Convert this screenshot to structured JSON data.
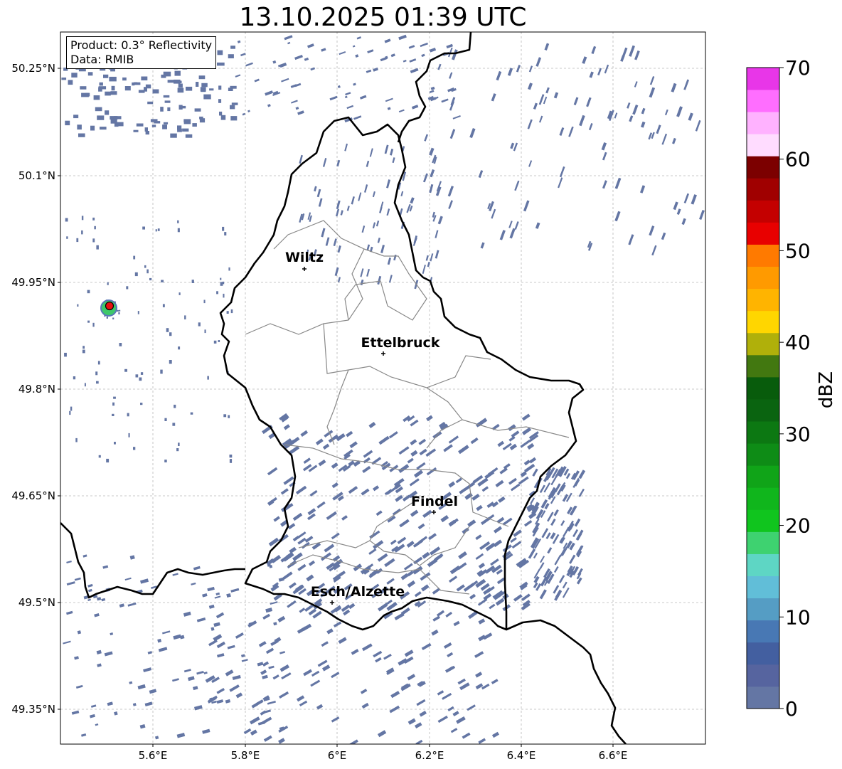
{
  "title": "13.10.2025 01:39 UTC",
  "info": {
    "product": "Product: 0.3° Reflectivity",
    "data_source": "Data: RMIB"
  },
  "map": {
    "lat_ticks": [
      "50.25°N",
      "50.1°N",
      "49.95°N",
      "49.8°N",
      "49.65°N",
      "49.5°N",
      "49.35°N"
    ],
    "lon_ticks": [
      "5.6°E",
      "5.8°E",
      "6°E",
      "6.2°E",
      "6.4°E",
      "6.6°E"
    ],
    "cities": [
      {
        "name": "Wiltz"
      },
      {
        "name": "Ettelbruck"
      },
      {
        "name": "Findel"
      },
      {
        "name": "Esch/Alzette"
      }
    ],
    "radar_site_color": "#e81010",
    "echo_color": "#6476a4",
    "border_color": "#000000",
    "district_color": "#888888"
  },
  "colorbar": {
    "label": "dBZ",
    "ticks": [
      "0",
      "10",
      "20",
      "30",
      "40",
      "50",
      "60",
      "70"
    ],
    "colors": [
      "#6476a4",
      "#56649f",
      "#435fa0",
      "#4878b4",
      "#559dc4",
      "#61bed8",
      "#5ed6c4",
      "#3ed270",
      "#10c51e",
      "#10b61c",
      "#10a418",
      "#0e8c16",
      "#0c7812",
      "#0a6410",
      "#085c0c",
      "#427810",
      "#b0b00a",
      "#ffd600",
      "#ffb400",
      "#ff9a00",
      "#ff7a00",
      "#e80000",
      "#c40000",
      "#a00000",
      "#7c0000",
      "#ffdcff",
      "#ffb2ff",
      "#ff6eff",
      "#e836e8"
    ]
  }
}
